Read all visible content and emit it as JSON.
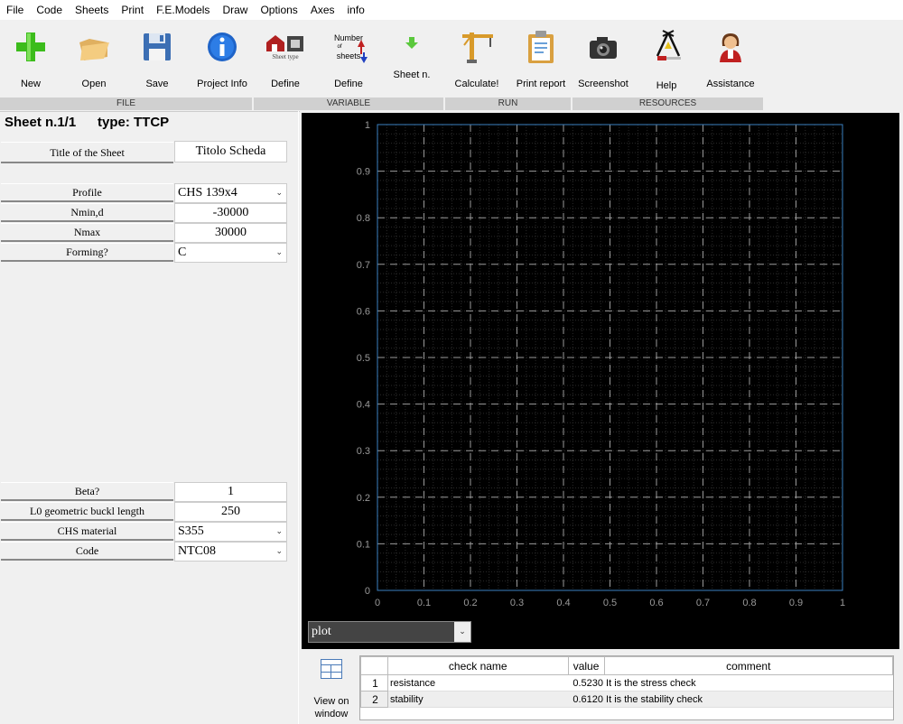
{
  "menu": [
    "File",
    "Code",
    "Sheets",
    "Print",
    "F.E.Models",
    "Draw",
    "Options",
    "Axes",
    "info"
  ],
  "toolbar": {
    "new": "New",
    "open": "Open",
    "save": "Save",
    "project_info": "Project Info",
    "define_type": "Define",
    "sheet_type_caption": "Sheet type",
    "define_number": "Define",
    "number_caption_1": "Number",
    "number_caption_2": "of",
    "number_caption_3": "sheets",
    "sheet_n": "Sheet n.",
    "calculate": "Calculate!",
    "print_report": "Print report",
    "screenshot": "Screenshot",
    "help": "Help",
    "assistance": "Assistance"
  },
  "groups": {
    "file": "FILE",
    "variable": "VARIABLE",
    "run": "RUN",
    "resources": "RESOURCES"
  },
  "sheet": {
    "title": "Sheet n.1/1",
    "type": "type: TTCP"
  },
  "fields": {
    "title_label": "Title of the Sheet",
    "title_value": "Titolo Scheda",
    "profile_label": "Profile",
    "profile_value": "CHS 139x4",
    "nmin_label": "Nmin,d",
    "nmin_value": "-30000",
    "nmax_label": "Nmax",
    "nmax_value": "30000",
    "forming_label": "Forming?",
    "forming_value": "C",
    "beta_label": "Beta?",
    "beta_value": "1",
    "l0_label": "L0 geometric buckl length",
    "l0_value": "250",
    "material_label": "CHS material",
    "material_value": "S355",
    "code_label": "Code",
    "code_value": "NTC08"
  },
  "chart_data": {
    "type": "line",
    "xlim": [
      0,
      1
    ],
    "ylim": [
      0,
      1
    ],
    "xticks": [
      "0",
      "0.1",
      "0.2",
      "0.3",
      "0.4",
      "0.5",
      "0.6",
      "0.7",
      "0.8",
      "0.9",
      "1"
    ],
    "yticks": [
      "0",
      "0.1",
      "0.2",
      "0.3",
      "0.4",
      "0.5",
      "0.6",
      "0.7",
      "0.8",
      "0.9",
      "1"
    ],
    "grid": true,
    "series": []
  },
  "plot_select": "plot",
  "view_window": {
    "line1": "View on",
    "line2": "window"
  },
  "results": {
    "headers": [
      "check name",
      "value",
      "comment"
    ],
    "rows": [
      {
        "n": "1",
        "name": "resistance",
        "value": "0.5230",
        "comment": "It is the stress check"
      },
      {
        "n": "2",
        "name": "stability",
        "value": "0.6120",
        "comment": "It is the stability check"
      }
    ]
  },
  "colors": {
    "plot_bg": "#000000",
    "axis": "#3a7fc0",
    "grid": "#9a9a9a"
  }
}
